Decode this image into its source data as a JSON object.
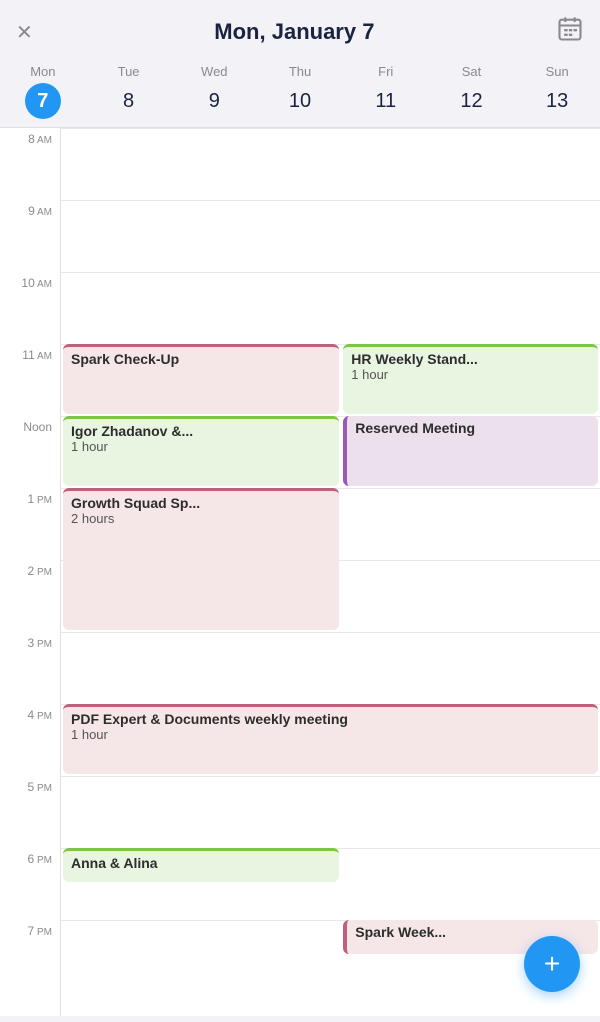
{
  "header": {
    "title": "Mon, January 7",
    "close_label": "×",
    "calendar_icon": "📅"
  },
  "days": [
    {
      "name": "Mon",
      "num": "7",
      "today": true
    },
    {
      "name": "Tue",
      "num": "8",
      "today": false
    },
    {
      "name": "Wed",
      "num": "9",
      "today": false
    },
    {
      "name": "Thu",
      "num": "10",
      "today": false
    },
    {
      "name": "Fri",
      "num": "11",
      "today": false
    },
    {
      "name": "Sat",
      "num": "12",
      "today": false
    },
    {
      "name": "Sun",
      "num": "13",
      "today": false
    }
  ],
  "time_slots": [
    {
      "label": "8",
      "ampm": "AM"
    },
    {
      "label": "9",
      "ampm": "AM"
    },
    {
      "label": "10",
      "ampm": "AM"
    },
    {
      "label": "11",
      "ampm": "AM"
    },
    {
      "label": "Noon",
      "ampm": ""
    },
    {
      "label": "1",
      "ampm": "PM"
    },
    {
      "label": "2",
      "ampm": "PM"
    },
    {
      "label": "3",
      "ampm": "PM"
    },
    {
      "label": "4",
      "ampm": "PM"
    },
    {
      "label": "5",
      "ampm": "PM"
    },
    {
      "label": "6",
      "ampm": "PM"
    },
    {
      "label": "7",
      "ampm": "PM"
    }
  ],
  "events": [
    {
      "id": "spark-checkup",
      "title": "Spark Check-Up",
      "duration": "",
      "color": "pink",
      "top_hour": 11,
      "top_min": 0,
      "duration_hours": 1,
      "left_pct": 0,
      "width_pct": 52
    },
    {
      "id": "hr-weekly",
      "title": "HR Weekly Stand...",
      "duration": "1 hour",
      "color": "green",
      "top_hour": 11,
      "top_min": 0,
      "duration_hours": 1,
      "left_pct": 52,
      "width_pct": 48
    },
    {
      "id": "igor-zhadanov",
      "title": "Igor Zhadanov &...",
      "duration": "1 hour",
      "color": "green",
      "top_hour": 12,
      "top_min": 0,
      "duration_hours": 1,
      "left_pct": 0,
      "width_pct": 52
    },
    {
      "id": "reserved-meeting",
      "title": "Reserved Meeting",
      "duration": "",
      "color": "mauve",
      "top_hour": 12,
      "top_min": 0,
      "duration_hours": 1,
      "left_pct": 52,
      "width_pct": 48
    },
    {
      "id": "growth-squad",
      "title": "Growth Squad Sp...",
      "duration": "2 hours",
      "color": "pink",
      "top_hour": 13,
      "top_min": 0,
      "duration_hours": 2,
      "left_pct": 0,
      "width_pct": 52
    },
    {
      "id": "pdf-expert",
      "title": "PDF Expert & Documents weekly meeting",
      "duration": "1 hour",
      "color": "pink",
      "top_hour": 16,
      "top_min": 0,
      "duration_hours": 1,
      "left_pct": 0,
      "width_pct": 100
    },
    {
      "id": "anna-alina",
      "title": "Anna & Alina",
      "duration": "",
      "color": "green",
      "top_hour": 18,
      "top_min": 0,
      "duration_hours": 0.5,
      "left_pct": 0,
      "width_pct": 52
    },
    {
      "id": "spark-week",
      "title": "Spark Week...",
      "duration": "",
      "color": "pink-side",
      "top_hour": 19,
      "top_min": 0,
      "duration_hours": 0.5,
      "left_pct": 52,
      "width_pct": 48
    }
  ],
  "fab_label": "+"
}
